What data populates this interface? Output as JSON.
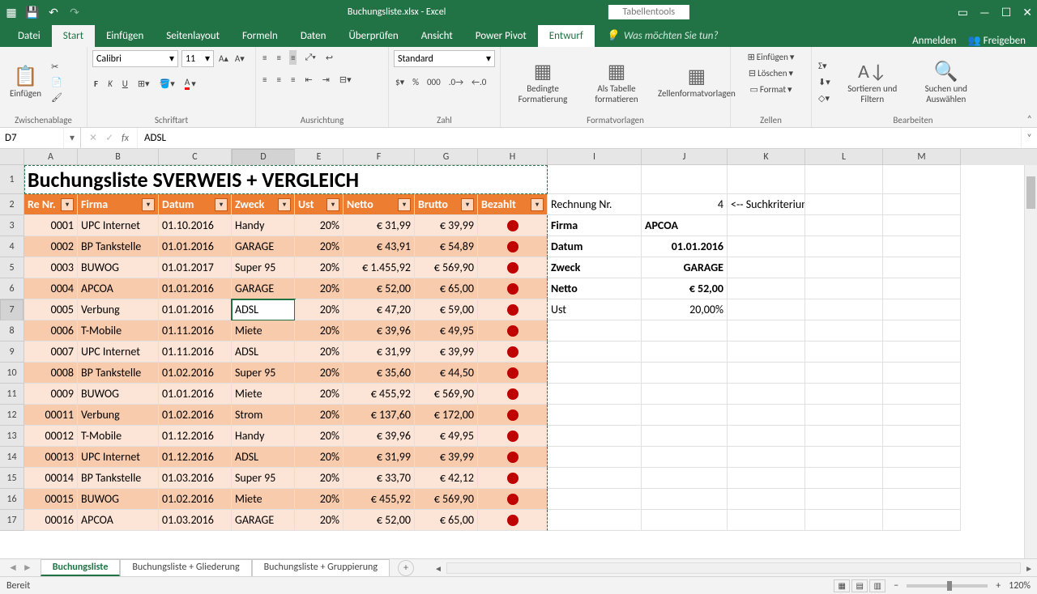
{
  "titlebar": {
    "filename": "Buchungsliste.xlsx - Excel",
    "tools": "Tabellentools"
  },
  "tabs": {
    "file": "Datei",
    "home": "Start",
    "insert": "Einfügen",
    "pagelayout": "Seitenlayout",
    "formulas": "Formeln",
    "data": "Daten",
    "review": "Überprüfen",
    "view": "Ansicht",
    "powerpivot": "Power Pivot",
    "design": "Entwurf",
    "tellme": "Was möchten Sie tun?",
    "signin": "Anmelden",
    "share": "Freigeben"
  },
  "ribbon": {
    "clipboard": {
      "paste": "Einfügen",
      "label": "Zwischenablage"
    },
    "font": {
      "name": "Calibri",
      "size": "11",
      "label": "Schriftart"
    },
    "align": {
      "label": "Ausrichtung"
    },
    "number": {
      "format": "Standard",
      "label": "Zahl"
    },
    "styles": {
      "cond": "Bedingte Formatierung",
      "table": "Als Tabelle formatieren",
      "cellstyles": "Zellenformatvorlagen",
      "label": "Formatvorlagen"
    },
    "cells": {
      "insert": "Einfügen",
      "delete": "Löschen",
      "format": "Format",
      "label": "Zellen"
    },
    "editing": {
      "sort": "Sortieren und Filtern",
      "find": "Suchen und Auswählen",
      "label": "Bearbeiten"
    }
  },
  "namebox": "D7",
  "formula": "ADSL",
  "columns": [
    "A",
    "B",
    "C",
    "D",
    "E",
    "F",
    "G",
    "H",
    "I",
    "J",
    "K",
    "L",
    "M"
  ],
  "title": "Buchungsliste SVERWEIS + VERGLEICH",
  "headers": [
    "Re Nr.",
    "Firma",
    "Datum",
    "Zweck",
    "Ust",
    "Netto",
    "Brutto",
    "Bezahlt"
  ],
  "rows": [
    {
      "n": "0001",
      "f": "UPC Internet",
      "d": "01.10.2016",
      "z": "Handy",
      "u": "20%",
      "nt": "€      31,99",
      "b": "€ 39,99"
    },
    {
      "n": "0002",
      "f": "BP Tankstelle",
      "d": "01.01.2016",
      "z": "GARAGE",
      "u": "20%",
      "nt": "€      43,91",
      "b": "€ 54,89"
    },
    {
      "n": "0003",
      "f": "BUWOG",
      "d": "01.01.2017",
      "z": "Super 95",
      "u": "20%",
      "nt": "€ 1.455,92",
      "b": "€ 569,90"
    },
    {
      "n": "0004",
      "f": "APCOA",
      "d": "01.01.2016",
      "z": "GARAGE",
      "u": "20%",
      "nt": "€      52,00",
      "b": "€ 65,00"
    },
    {
      "n": "0005",
      "f": "Verbung",
      "d": "01.01.2016",
      "z": "ADSL",
      "u": "20%",
      "nt": "€      47,20",
      "b": "€ 59,00"
    },
    {
      "n": "0006",
      "f": "T-Mobile",
      "d": "01.11.2016",
      "z": "Miete",
      "u": "20%",
      "nt": "€      39,96",
      "b": "€ 49,95"
    },
    {
      "n": "0007",
      "f": "UPC Internet",
      "d": "01.11.2016",
      "z": "ADSL",
      "u": "20%",
      "nt": "€      31,99",
      "b": "€ 39,99"
    },
    {
      "n": "0008",
      "f": "BP Tankstelle",
      "d": "01.02.2016",
      "z": "Super 95",
      "u": "20%",
      "nt": "€      35,60",
      "b": "€ 44,50"
    },
    {
      "n": "0009",
      "f": "BUWOG",
      "d": "01.01.2016",
      "z": "Miete",
      "u": "20%",
      "nt": "€    455,92",
      "b": "€ 569,90"
    },
    {
      "n": "00011",
      "f": "Verbung",
      "d": "01.02.2016",
      "z": "Strom",
      "u": "20%",
      "nt": "€    137,60",
      "b": "€ 172,00"
    },
    {
      "n": "00012",
      "f": "T-Mobile",
      "d": "01.12.2016",
      "z": "Handy",
      "u": "20%",
      "nt": "€      39,96",
      "b": "€ 49,95"
    },
    {
      "n": "00013",
      "f": "UPC Internet",
      "d": "01.12.2016",
      "z": "ADSL",
      "u": "20%",
      "nt": "€      31,99",
      "b": "€ 39,99"
    },
    {
      "n": "00014",
      "f": "BP Tankstelle",
      "d": "01.03.2016",
      "z": "Super 95",
      "u": "20%",
      "nt": "€      33,70",
      "b": "€ 42,12"
    },
    {
      "n": "00015",
      "f": "BUWOG",
      "d": "01.02.2016",
      "z": "Miete",
      "u": "20%",
      "nt": "€    455,92",
      "b": "€ 569,90"
    },
    {
      "n": "00016",
      "f": "APCOA",
      "d": "01.03.2016",
      "z": "GARAGE",
      "u": "20%",
      "nt": "€      52,00",
      "b": "€ 65,00"
    }
  ],
  "lookup": {
    "criterion_label": "Rechnung Nr.",
    "criterion_value": "4",
    "hint": "<-- Suchkriterium",
    "fields": [
      {
        "k": "Firma",
        "v": "APCOA"
      },
      {
        "k": "Datum",
        "v": "01.01.2016"
      },
      {
        "k": "Zweck",
        "v": "GARAGE"
      },
      {
        "k": "Netto",
        "v": "€ 52,00"
      },
      {
        "k": "Ust",
        "v": "20,00%"
      }
    ]
  },
  "sheets": [
    "Buchungsliste",
    "Buchungsliste + Gliederung",
    "Buchungsliste + Gruppierung"
  ],
  "status": "Bereit",
  "zoom": "120%"
}
